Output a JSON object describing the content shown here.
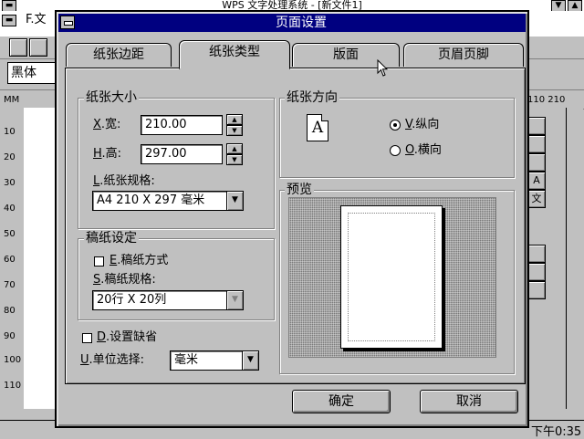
{
  "app": {
    "title": "WPS 文字处理系统 - [新文件1]",
    "menu_first": "F.文",
    "font_name": "黑体",
    "ruler_unit": "MM",
    "ruler_right_labels": "110  210",
    "vertical_ruler_marks": [
      "10",
      "20",
      "30",
      "40",
      "50",
      "60",
      "70",
      "80",
      "90",
      "100",
      "110"
    ],
    "right_panel_glyphs": [
      "",
      "",
      "",
      "A",
      "文"
    ],
    "status_time": "下午0:35"
  },
  "dialog": {
    "title": "页面设置",
    "tabs": [
      {
        "label": "纸张边距"
      },
      {
        "label": "纸张类型",
        "active": true
      },
      {
        "label": "版面"
      },
      {
        "label": "页眉页脚"
      }
    ],
    "paper_size": {
      "group_label": "纸张大小",
      "width_key": "X",
      "width_label": ".宽:",
      "width_value": "210.00",
      "height_key": "H",
      "height_label": ".高:",
      "height_value": "297.00",
      "spec_key": "L",
      "spec_label": ".纸张规格:",
      "spec_value": "A4 210 X 297 毫米"
    },
    "grid_paper": {
      "group_label": "稿纸设定",
      "mode_key": "E",
      "mode_label": ".稿纸方式",
      "mode_checked": false,
      "spec_key": "S",
      "spec_label": ".稿纸规格:",
      "spec_value": "20行 X 20列"
    },
    "default_key": "D",
    "default_label": ".设置缺省",
    "default_checked": false,
    "unit_key": "U",
    "unit_label": ".单位选择:",
    "unit_value": "毫米",
    "orientation": {
      "group_label": "纸张方向",
      "icon_letter": "A",
      "portrait_key": "V",
      "portrait_label": ".纵向",
      "landscape_key": "O",
      "landscape_label": ".横向",
      "selected": "portrait"
    },
    "preview": {
      "group_label": "预览"
    },
    "ok_label": "确定",
    "cancel_label": "取消"
  }
}
